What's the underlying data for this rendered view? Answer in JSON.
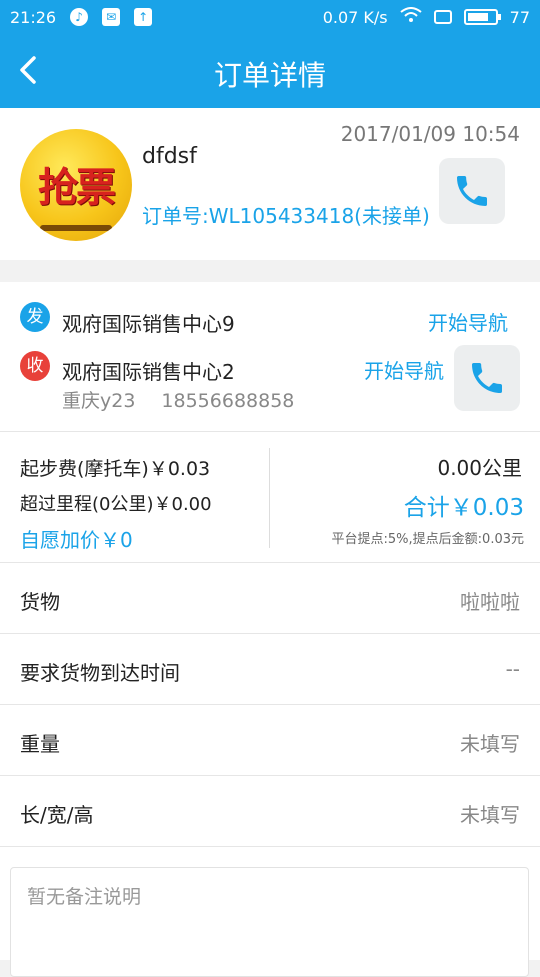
{
  "status_bar": {
    "time": "21:26",
    "speed": "0.07 K/s",
    "battery": "77",
    "battery_level": 0.77
  },
  "app_bar": {
    "title": "订单详情",
    "back_icon": "chevron-left-icon"
  },
  "order": {
    "avatar_text": "抢票",
    "user_name": "dfdsf",
    "time": "2017/01/09 10:54",
    "order_no": "订单号:WL105433418(未接单)"
  },
  "route": {
    "from_badge": "发",
    "from_address": "观府国际销售中心9",
    "to_badge": "收",
    "to_address": "观府国际销售中心2",
    "nav_label": "开始导航",
    "contact_name": "重庆y23",
    "contact_phone": "18556688858"
  },
  "fees": {
    "start_fee": "起步费(摩托车)￥0.03",
    "extra_mileage": "超过里程(0公里)￥0.00",
    "voluntary_markup": "自愿加价￥0",
    "distance": "0.00公里",
    "total": "合计￥0.03",
    "platform_note": "平台提点:5%,提点后金额:0.03元"
  },
  "details": [
    {
      "label": "货物",
      "value": "啦啦啦"
    },
    {
      "label": "要求货物到达时间",
      "value": "--"
    },
    {
      "label": "重量",
      "value": "未填写"
    },
    {
      "label": "长/宽/高",
      "value": "未填写"
    }
  ],
  "remark": {
    "placeholder": "暂无备注说明"
  },
  "colors": {
    "primary": "#1aa3e8",
    "receive_badge": "#e8413a"
  }
}
